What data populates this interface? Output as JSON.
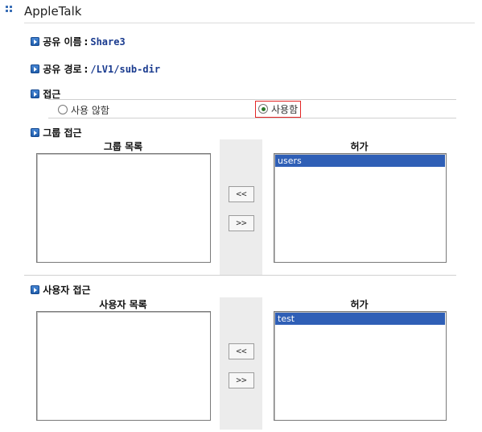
{
  "header": {
    "title": "AppleTalk"
  },
  "share_name": {
    "label": "공유 이름",
    "sep": ":",
    "value": "Share3"
  },
  "share_path": {
    "label": "공유 경로",
    "sep": ":",
    "value": "/LV1/sub-dir"
  },
  "access": {
    "label": "접근",
    "options": [
      {
        "label": "사용 않함",
        "selected": false
      },
      {
        "label": "사용함",
        "selected": true
      }
    ]
  },
  "group_access": {
    "label": "그룹 접근",
    "list_header": "그룹 목록",
    "allowed_header": "허가",
    "list_items": [],
    "allowed_items": [
      "users"
    ],
    "btn_left": "<<",
    "btn_right": ">>"
  },
  "user_access": {
    "label": "사용자 접근",
    "list_header": "사용자 목록",
    "allowed_header": "허가",
    "list_items": [],
    "allowed_items": [
      "test"
    ],
    "btn_left": "<<",
    "btn_right": ">>"
  }
}
